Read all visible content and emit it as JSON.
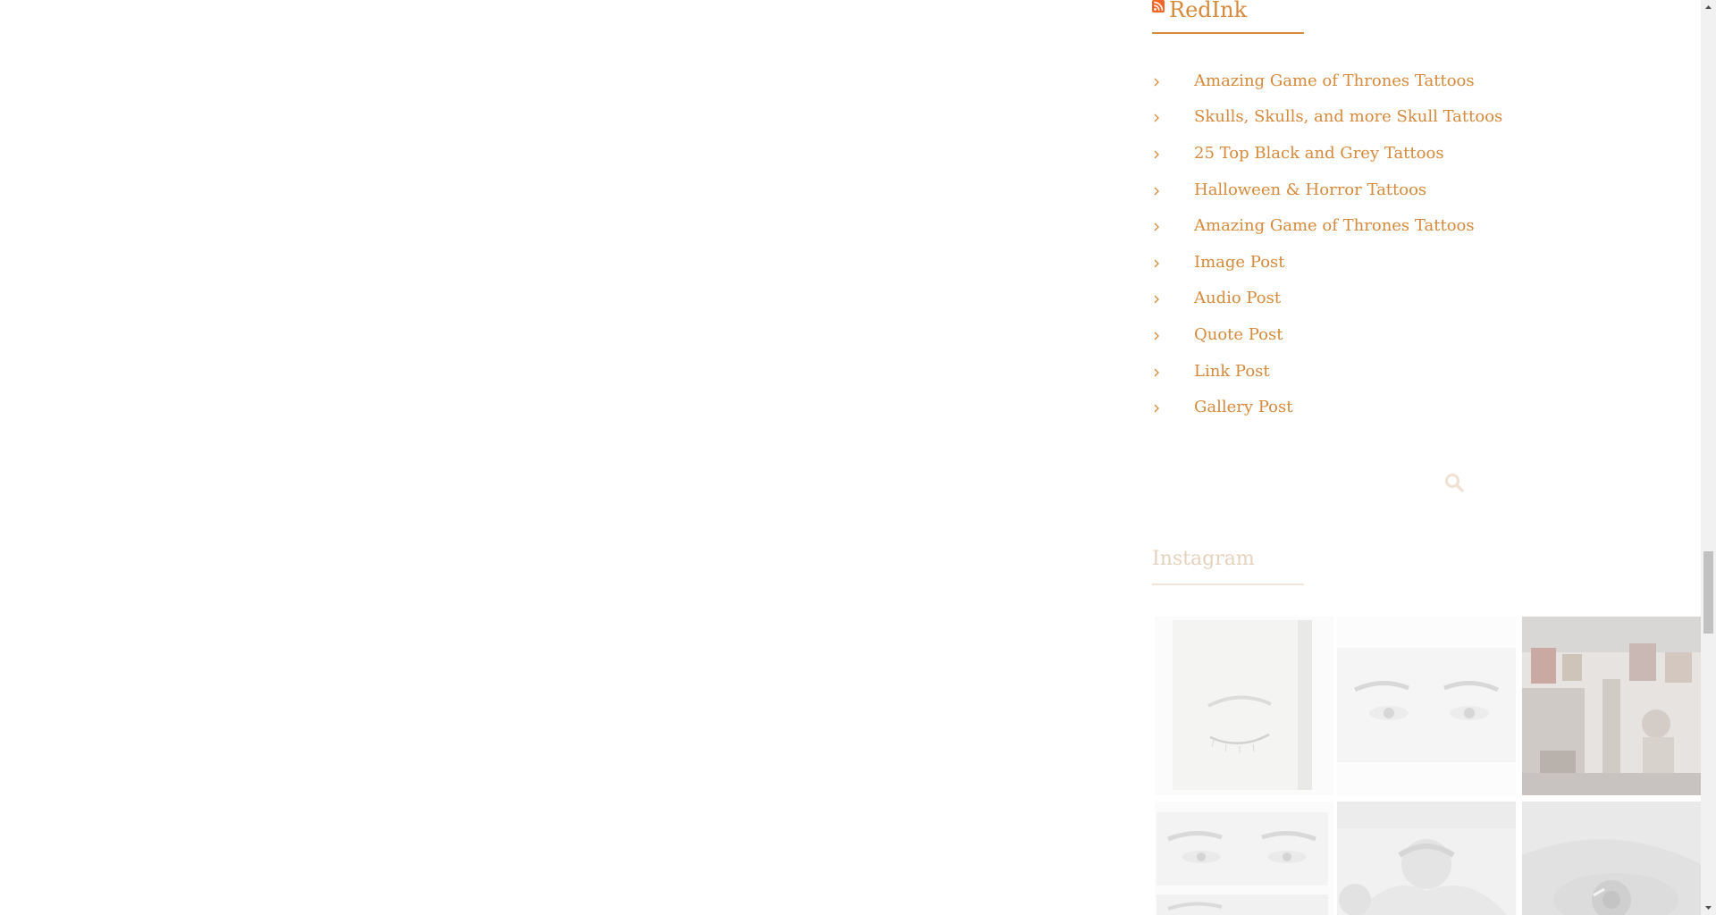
{
  "rss_widget": {
    "title": "RedInk",
    "icon": "rss-icon",
    "items": [
      {
        "label": "Amazing Game of Thrones Tattoos"
      },
      {
        "label": "Skulls, Skulls, and more Skull Tattoos"
      },
      {
        "label": "25 Top Black and Grey Tattoos"
      },
      {
        "label": "Halloween & Horror Tattoos"
      },
      {
        "label": "Amazing Game of Thrones Tattoos"
      },
      {
        "label": "Image Post"
      },
      {
        "label": "Audio Post"
      },
      {
        "label": "Quote Post"
      },
      {
        "label": "Link Post"
      },
      {
        "label": "Gallery Post"
      }
    ]
  },
  "search": {
    "placeholder": "",
    "icon": "search-icon"
  },
  "instagram": {
    "title": "Instagram",
    "images": [
      {
        "subject": "eye-closed"
      },
      {
        "subject": "eyes-brows"
      },
      {
        "subject": "tattoo-shop"
      },
      {
        "subject": "eyes-brows"
      },
      {
        "subject": "tattoo-artist"
      },
      {
        "subject": "eye-closeup"
      }
    ]
  },
  "colors": {
    "accent": "#d6893a",
    "faded_title": "#e4d2bc",
    "rss_orange": "#f26522"
  }
}
